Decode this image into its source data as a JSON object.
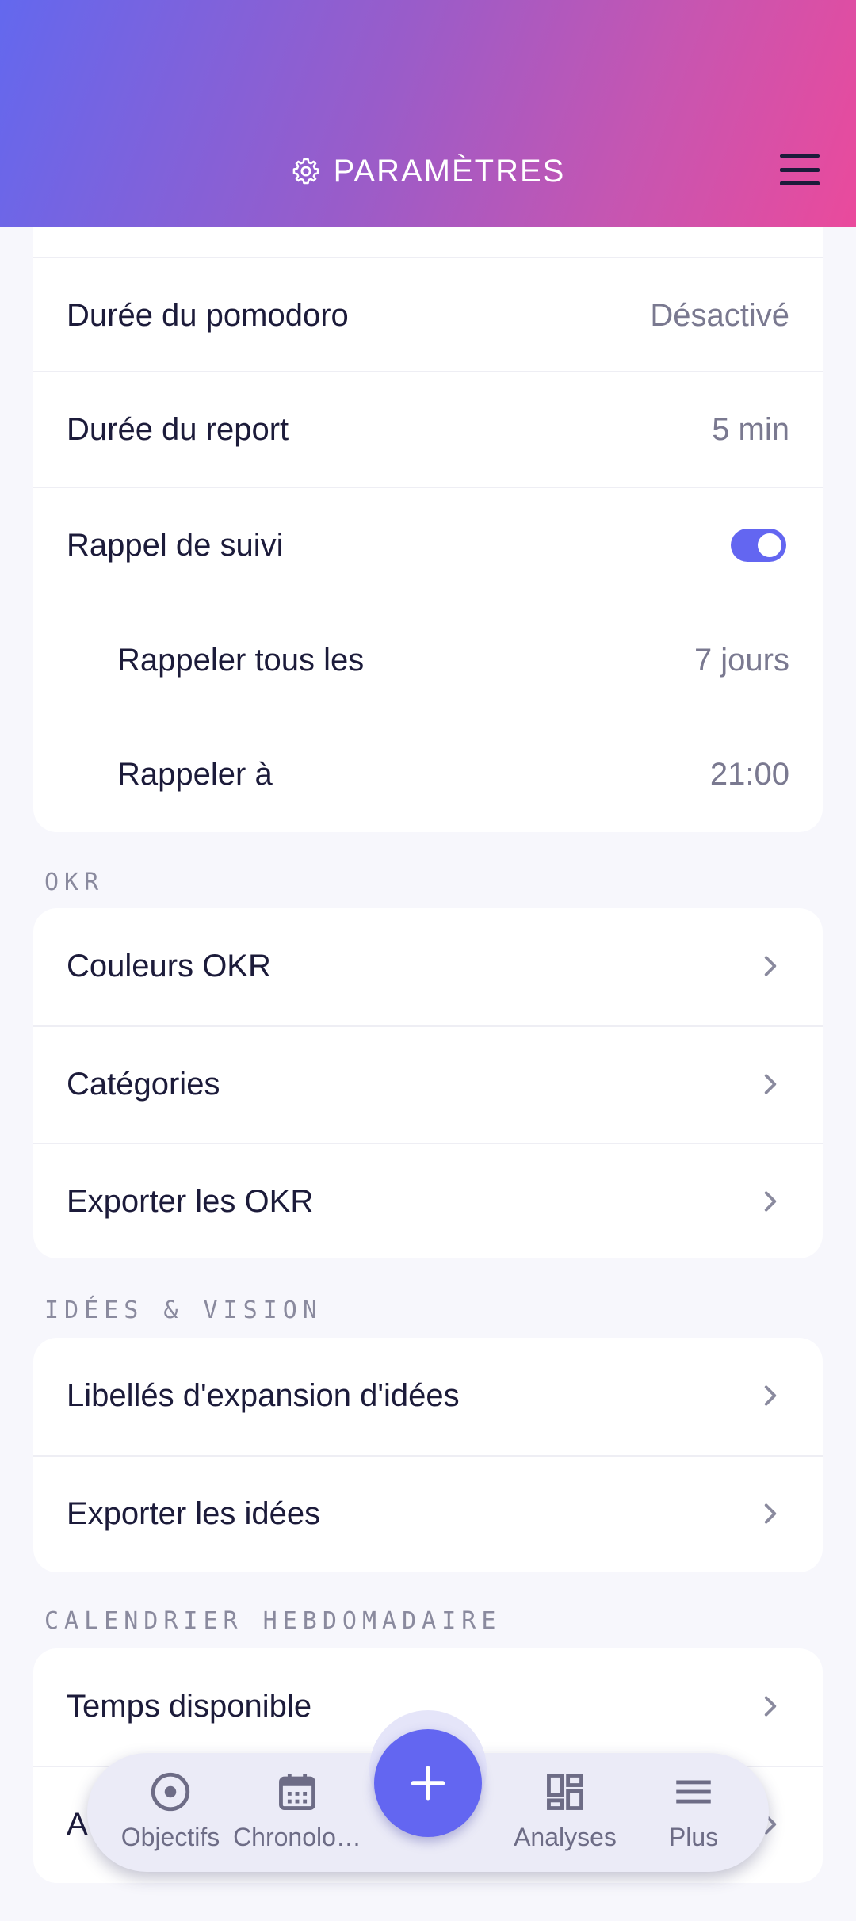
{
  "header": {
    "title": "PARAMÈTRES",
    "title_icon": "gear-icon",
    "menu_icon": "hamburger-menu-icon"
  },
  "timer_card": {
    "rows": [
      {
        "label": "Durée du pomodoro",
        "value": "Désactivé"
      },
      {
        "label": "Durée du report",
        "value": "5 min"
      },
      {
        "label": "Rappel de suivi",
        "toggle": true
      },
      {
        "label": "Rappeler tous les",
        "value": "7 jours"
      },
      {
        "label": "Rappeler à",
        "value": "21:00"
      }
    ]
  },
  "okr": {
    "section_label": "OKR",
    "rows": [
      {
        "label": "Couleurs OKR"
      },
      {
        "label": "Catégories"
      },
      {
        "label": "Exporter les OKR"
      }
    ]
  },
  "ideas": {
    "section_label": "IDÉES & VISION",
    "rows": [
      {
        "label": "Libellés d'expansion d'idées"
      },
      {
        "label": "Exporter les idées"
      }
    ]
  },
  "calendar": {
    "section_label": "CALENDRIER HEBDOMADAIRE",
    "rows": [
      {
        "label": "Temps disponible"
      },
      {
        "label": "A"
      }
    ]
  },
  "bottom_nav": {
    "items": [
      {
        "label": "Objectifs",
        "icon": "target-icon"
      },
      {
        "label": "Chronolo…",
        "icon": "calendar-icon"
      },
      {
        "label": "Analyses",
        "icon": "dashboard-icon"
      },
      {
        "label": "Plus",
        "icon": "menu-icon"
      }
    ],
    "fab_icon": "plus-icon"
  },
  "colors": {
    "accent": "#6366f1",
    "header_start": "#6368ee",
    "header_end": "#ea4a9c"
  }
}
